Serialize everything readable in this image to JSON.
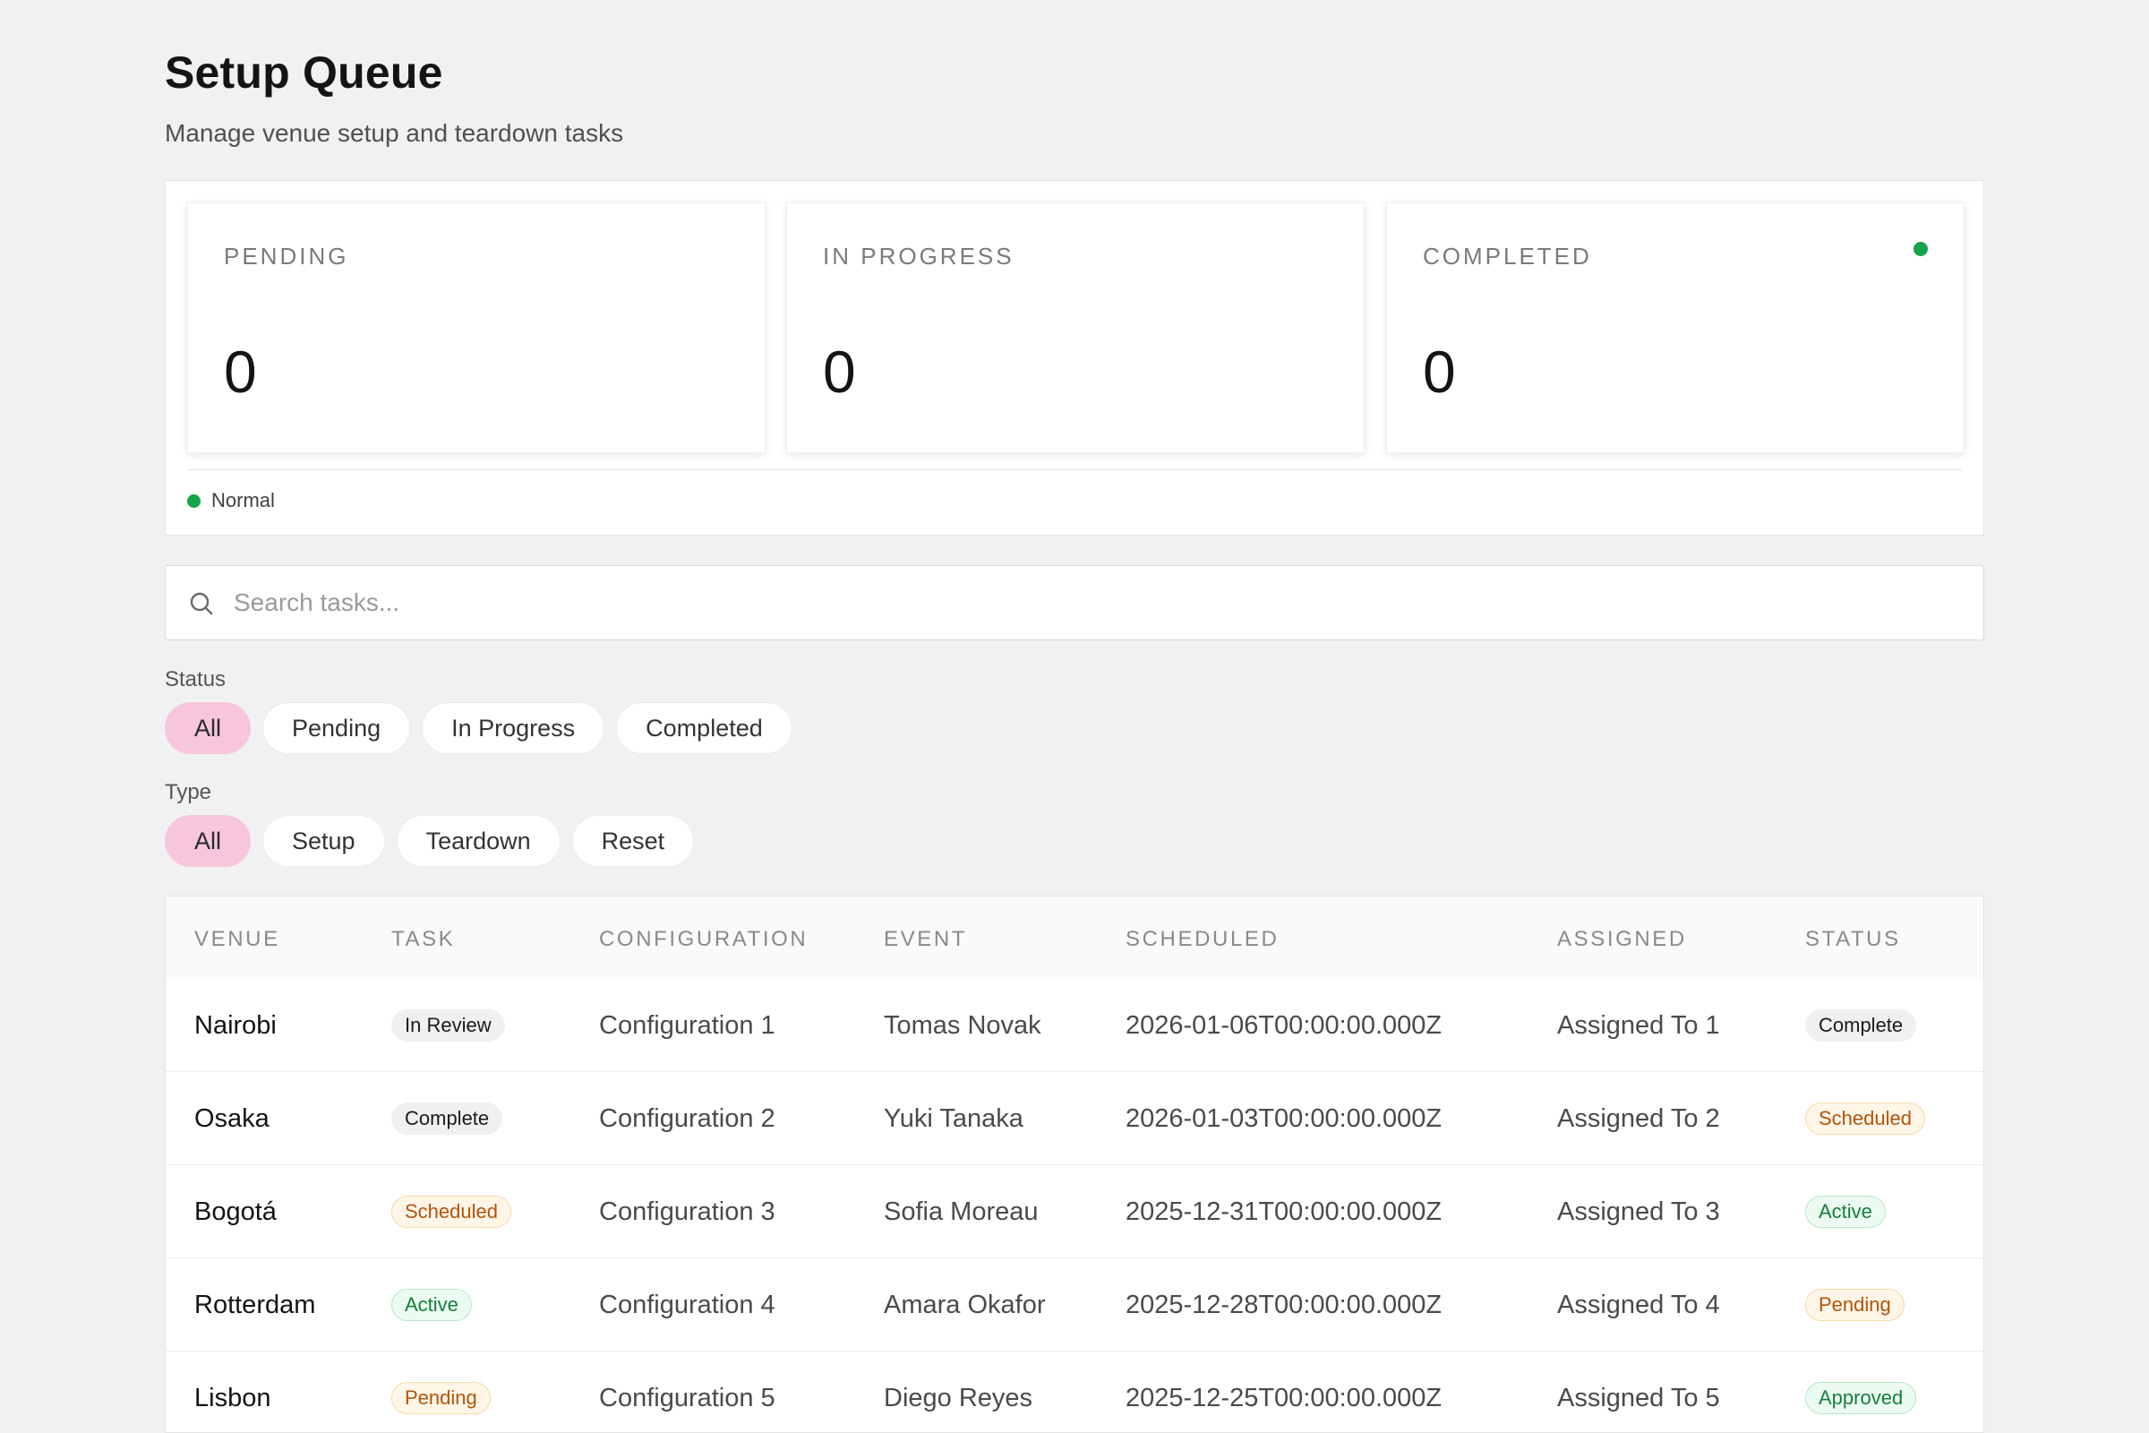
{
  "header": {
    "title": "Setup Queue",
    "subtitle": "Manage venue setup and teardown tasks"
  },
  "stats": [
    {
      "label": "PENDING",
      "value": "0"
    },
    {
      "label": "IN PROGRESS",
      "value": "0"
    },
    {
      "label": "COMPLETED",
      "value": "0"
    }
  ],
  "health": {
    "label": "Normal",
    "color": "#16a34a"
  },
  "search": {
    "placeholder": "Search tasks...",
    "value": ""
  },
  "filters": {
    "status": {
      "label": "Status",
      "options": [
        "All",
        "Pending",
        "In Progress",
        "Completed"
      ],
      "selected": "All"
    },
    "type": {
      "label": "Type",
      "options": [
        "All",
        "Setup",
        "Teardown",
        "Reset"
      ],
      "selected": "All"
    }
  },
  "table": {
    "columns": [
      "VENUE",
      "TASK",
      "CONFIGURATION",
      "EVENT",
      "SCHEDULED",
      "ASSIGNED",
      "STATUS"
    ],
    "rows": [
      {
        "venue": "Nairobi",
        "task": "In Review",
        "task_tone": "neutral",
        "configuration": "Configuration 1",
        "event": "Tomas Novak",
        "scheduled": "2026-01-06T00:00:00.000Z",
        "assigned": "Assigned To 1",
        "status": "Complete",
        "status_tone": "neutral"
      },
      {
        "venue": "Osaka",
        "task": "Complete",
        "task_tone": "neutral",
        "configuration": "Configuration 2",
        "event": "Yuki Tanaka",
        "scheduled": "2026-01-03T00:00:00.000Z",
        "assigned": "Assigned To 2",
        "status": "Scheduled",
        "status_tone": "orange"
      },
      {
        "venue": "Bogotá",
        "task": "Scheduled",
        "task_tone": "orange",
        "configuration": "Configuration 3",
        "event": "Sofia Moreau",
        "scheduled": "2025-12-31T00:00:00.000Z",
        "assigned": "Assigned To 3",
        "status": "Active",
        "status_tone": "green"
      },
      {
        "venue": "Rotterdam",
        "task": "Active",
        "task_tone": "green",
        "configuration": "Configuration 4",
        "event": "Amara Okafor",
        "scheduled": "2025-12-28T00:00:00.000Z",
        "assigned": "Assigned To 4",
        "status": "Pending",
        "status_tone": "orange"
      },
      {
        "venue": "Lisbon",
        "task": "Pending",
        "task_tone": "orange",
        "configuration": "Configuration 5",
        "event": "Diego Reyes",
        "scheduled": "2025-12-25T00:00:00.000Z",
        "assigned": "Assigned To 5",
        "status": "Approved",
        "status_tone": "green"
      }
    ]
  },
  "colors": {
    "accent_chip": "#f7c6dc",
    "status_ok": "#16a34a",
    "badge_orange": "#b45309",
    "badge_green": "#15803d"
  },
  "icons": {
    "search": "search-icon",
    "stat_indicator": "status-dot"
  }
}
